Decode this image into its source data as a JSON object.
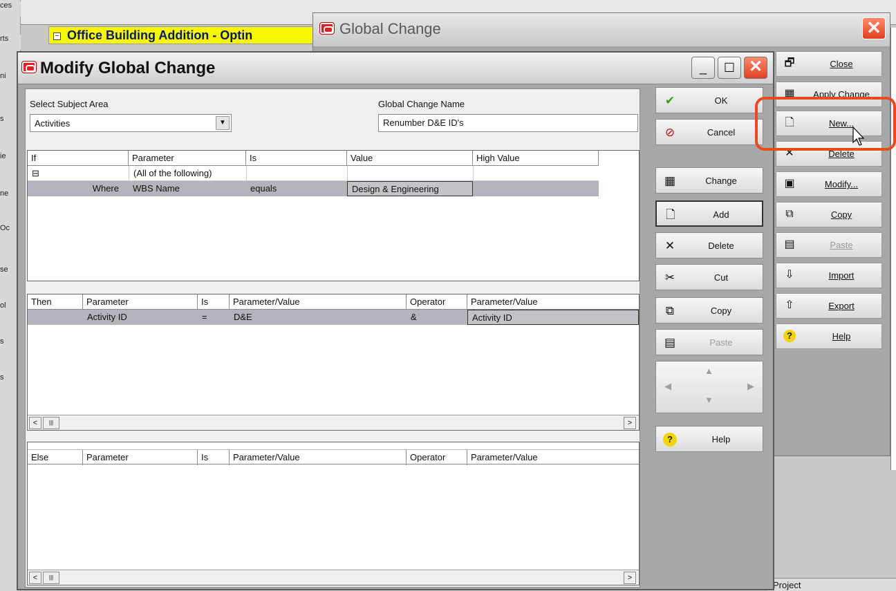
{
  "background": {
    "left_items": [
      "ces",
      "rts",
      "ni",
      "s",
      "ie",
      "ne",
      "Oc",
      "se",
      "ol",
      "s",
      "s"
    ],
    "project_row": {
      "minus": "−",
      "title": "Office Building Addition - Optin"
    },
    "status_text": "Project"
  },
  "global_change": {
    "title": "Global Change",
    "close_glyph": "✕",
    "buttons": [
      {
        "label": "Close",
        "icon": "close-window-icon",
        "glyph": "🗗",
        "enabled": true
      },
      {
        "label": "Apply Change",
        "icon": "apply-change-icon",
        "glyph": "▦",
        "enabled": true
      },
      {
        "label": "New...",
        "icon": "new-document-icon",
        "glyph": "🗋",
        "enabled": true
      },
      {
        "label": "Delete",
        "icon": "delete-x-icon",
        "glyph": "✕",
        "enabled": true
      },
      {
        "label": "Modify...",
        "icon": "modify-icon",
        "glyph": "▣",
        "enabled": true
      },
      {
        "label": "Copy",
        "icon": "copy-icon",
        "glyph": "⧉",
        "enabled": true
      },
      {
        "label": "Paste",
        "icon": "paste-icon",
        "glyph": "▤",
        "enabled": false
      },
      {
        "label": "Import",
        "icon": "import-icon",
        "glyph": "⇩",
        "enabled": true
      },
      {
        "label": "Export",
        "icon": "export-icon",
        "glyph": "⇧",
        "enabled": true
      },
      {
        "label": "Help",
        "icon": "help-icon",
        "glyph": "?",
        "enabled": true
      }
    ],
    "accent_color": "#e84c1c"
  },
  "modify": {
    "title": "Modify Global Change",
    "window_buttons": {
      "minimize": "_",
      "maximize": "☐",
      "close": "✕"
    },
    "subject_area_label": "Select Subject Area",
    "subject_area_value": "Activities",
    "name_label": "Global Change Name",
    "name_value": "Renumber D&E ID's",
    "if_grid": {
      "headers": [
        "If",
        "Parameter",
        "Is",
        "Value",
        "High Value"
      ],
      "rows": [
        {
          "if": "⊟",
          "parameter": "(All of the following)",
          "is": "",
          "value": "",
          "high": ""
        },
        {
          "if": "Where",
          "parameter": "WBS Name",
          "is": "equals",
          "value": "Design & Engineering",
          "high": ""
        }
      ]
    },
    "then_grid": {
      "headers": [
        "Then",
        "Parameter",
        "Is",
        "Parameter/Value",
        "Operator",
        "Parameter/Value"
      ],
      "rows": [
        {
          "then": "",
          "parameter": "Activity ID",
          "is": "=",
          "value": "D&E",
          "operator": "&",
          "value2": "Activity ID"
        }
      ]
    },
    "else_grid": {
      "headers": [
        "Else",
        "Parameter",
        "Is",
        "Parameter/Value",
        "Operator",
        "Parameter/Value"
      ]
    },
    "scroll": {
      "left": "<",
      "right": ">",
      "thumb": "|||"
    },
    "actions": [
      {
        "label": "OK",
        "icon": "checkmark-icon",
        "glyph": "✔",
        "enabled": true
      },
      {
        "label": "Cancel",
        "icon": "cancel-icon",
        "glyph": "⊘",
        "enabled": true
      },
      {
        "label": "Change",
        "icon": "change-icon",
        "glyph": "▦",
        "enabled": true
      },
      {
        "label": "Add",
        "icon": "add-document-icon",
        "glyph": "🗋",
        "enabled": true
      },
      {
        "label": "Delete",
        "icon": "delete-x-icon",
        "glyph": "✕",
        "enabled": true
      },
      {
        "label": "Cut",
        "icon": "scissors-icon",
        "glyph": "✂",
        "enabled": true
      },
      {
        "label": "Copy",
        "icon": "copy-icon",
        "glyph": "⧉",
        "enabled": true
      },
      {
        "label": "Paste",
        "icon": "paste-icon",
        "glyph": "▤",
        "enabled": false
      }
    ],
    "nav": {
      "left": "◀",
      "up": "▲",
      "down": "▼",
      "right": "▶"
    },
    "help": {
      "label": "Help",
      "icon": "help-icon",
      "glyph": "?"
    }
  }
}
